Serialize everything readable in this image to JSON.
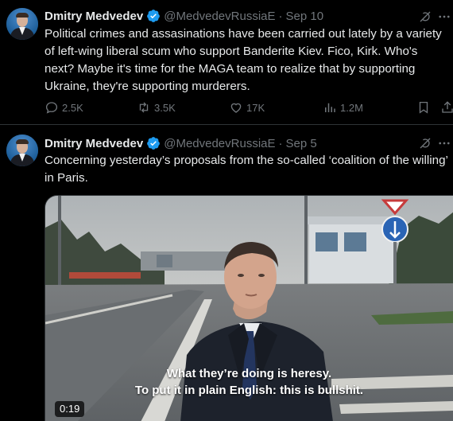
{
  "posts": [
    {
      "author": {
        "name": "Dmitry Medvedev",
        "handle": "@MedvedevRussiaE",
        "date": "Sep 10",
        "verified": true,
        "avatar": "avatar-photo"
      },
      "text": "Political crimes and assasinations have been carried out lately by a variety of left-wing liberal scum who support Banderite Kiev. Fico, Kirk. Who's next? Maybe it's time for the MAGA team to realize that by supporting Ukraine, they're supporting murderers.",
      "metrics": {
        "replies": "2.5K",
        "reposts": "3.5K",
        "likes": "17K",
        "views": "1.2M"
      },
      "icons": [
        "grok-icon",
        "more-icon",
        "reply-icon",
        "repost-icon",
        "like-icon",
        "views-icon",
        "bookmark-icon",
        "share-icon"
      ]
    },
    {
      "author": {
        "name": "Dmitry Medvedev",
        "handle": "@MedvedevRussiaE",
        "date": "Sep 5",
        "verified": true,
        "avatar": "avatar-photo"
      },
      "text": "Concerning yesterday’s proposals from the so-called ‘coalition of the willing’ in Paris.",
      "video": {
        "caption_line1": "What they’re doing is heresy.",
        "caption_line2": "To put it in plain English: this is bullshit.",
        "duration": "0:19"
      },
      "icons": [
        "grok-icon",
        "more-icon"
      ]
    }
  ],
  "colors": {
    "background": "#000000",
    "text": "#e7e9ea",
    "muted": "#71767b",
    "verified": "#1d9bf0",
    "divider": "#2f3336"
  },
  "separator": "·"
}
